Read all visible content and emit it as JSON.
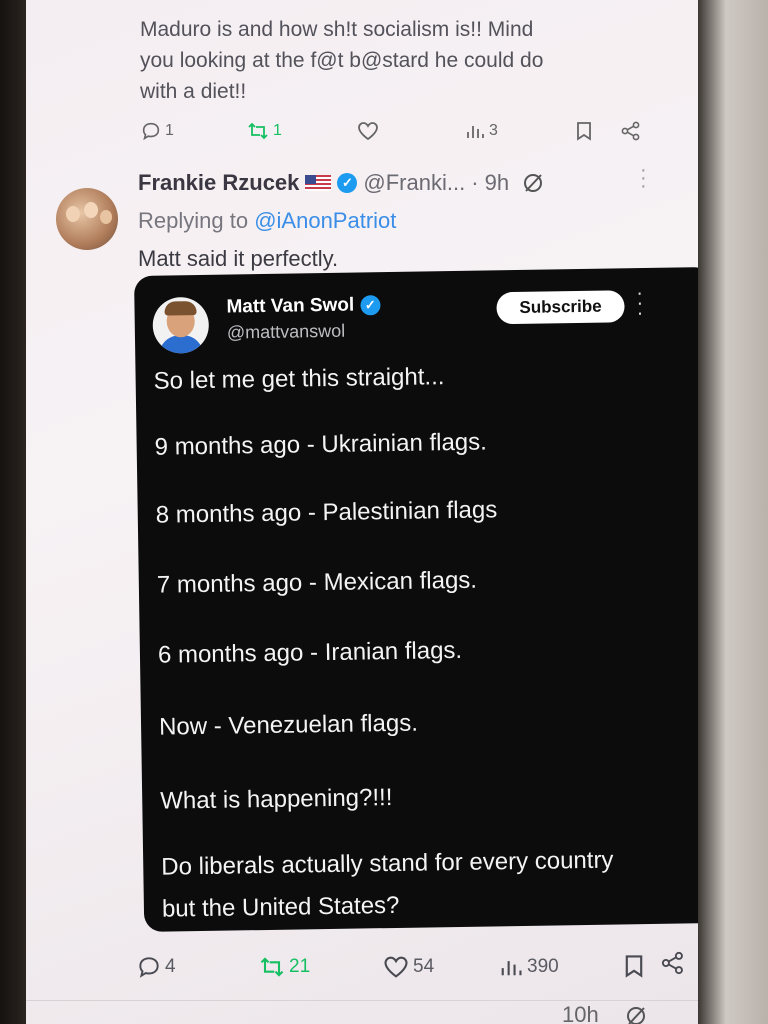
{
  "prev_tweet": {
    "lines": [
      "Maduro is and how sh!t socialism  is!! Mind",
      "you looking at the f@t b@stard he could do",
      "with a diet!!"
    ],
    "stats": {
      "replies": "1",
      "reposts": "1",
      "views": "3"
    }
  },
  "reply": {
    "display_name": "Frankie Rzucek",
    "handle": "@Franki...",
    "time": "· 9h",
    "replying_prefix": "Replying to",
    "replying_to": "@iAnonPatriot",
    "text": "Matt said it perfectly.",
    "stats": {
      "replies": "4",
      "reposts": "21",
      "likes": "54",
      "views": "390"
    }
  },
  "quoted": {
    "display_name": "Matt Van Swol",
    "handle": "@mattvanswol",
    "subscribe_label": "Subscribe",
    "lines": [
      "So let me get this straight...",
      "9 months ago - Ukrainian flags.",
      "8 months ago - Palestinian flags",
      "7 months ago - Mexican flags.",
      "6 months ago - Iranian flags.",
      "Now - Venezuelan flags.",
      "What is happening?!!!",
      "Do liberals actually stand for every country",
      "but the United States?"
    ]
  },
  "next_tweet": {
    "time": "10h"
  },
  "colors": {
    "accent": "#1d9bf0",
    "repost": "#17bf63",
    "card_bg": "#0c0c0d"
  }
}
